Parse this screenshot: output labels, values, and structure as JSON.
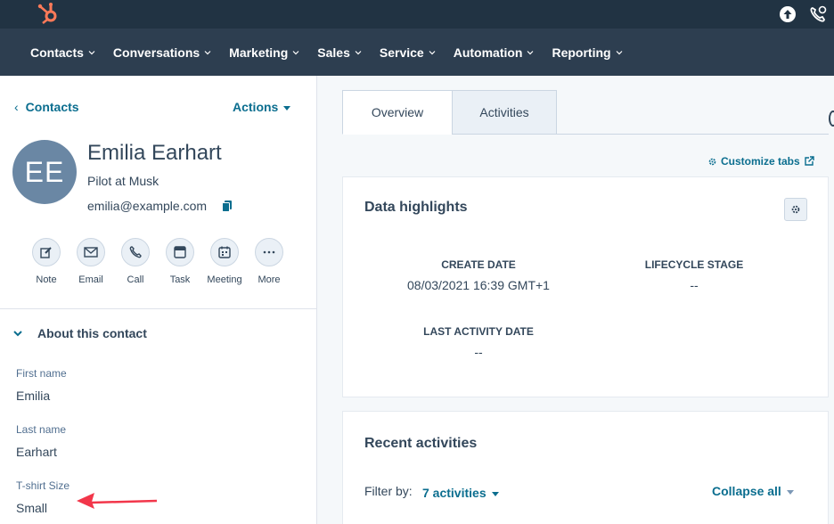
{
  "nav": {
    "items": [
      "Contacts",
      "Conversations",
      "Marketing",
      "Sales",
      "Service",
      "Automation",
      "Reporting"
    ]
  },
  "left": {
    "back_label": "Contacts",
    "actions_label": "Actions",
    "avatar_initials": "EE",
    "name": "Emilia Earhart",
    "title": "Pilot at Musk",
    "email": "emilia@example.com",
    "action_buttons": [
      {
        "label": "Note",
        "icon": "pencil-icon"
      },
      {
        "label": "Email",
        "icon": "envelope-icon"
      },
      {
        "label": "Call",
        "icon": "phone-icon"
      },
      {
        "label": "Task",
        "icon": "task-icon"
      },
      {
        "label": "Meeting",
        "icon": "calendar-icon"
      },
      {
        "label": "More",
        "icon": "ellipsis-icon"
      }
    ],
    "about_label": "About this contact",
    "properties": [
      {
        "label": "First name",
        "value": "Emilia"
      },
      {
        "label": "Last name",
        "value": "Earhart"
      },
      {
        "label": "T-shirt Size",
        "value": "Small"
      }
    ]
  },
  "right": {
    "tabs": [
      "Overview",
      "Activities"
    ],
    "customize_label": "Customize tabs",
    "data_highlights": {
      "title": "Data highlights",
      "items": [
        {
          "label": "CREATE DATE",
          "value": "08/03/2021 16:39 GMT+1"
        },
        {
          "label": "LIFECYCLE STAGE",
          "value": "--"
        },
        {
          "label": "LAST ACTIVITY DATE",
          "value": "--"
        }
      ]
    },
    "recent": {
      "title": "Recent activities",
      "filter_label": "Filter by:",
      "filter_value": "7 activities",
      "collapse_label": "Collapse all"
    }
  },
  "colors": {
    "topbar": "#213343",
    "navbar": "#2d3e50",
    "link": "#0b6e8f",
    "avatar": "#6a87a4",
    "brand": "#ff7a59",
    "annotation_arrow": "#f2364a"
  }
}
